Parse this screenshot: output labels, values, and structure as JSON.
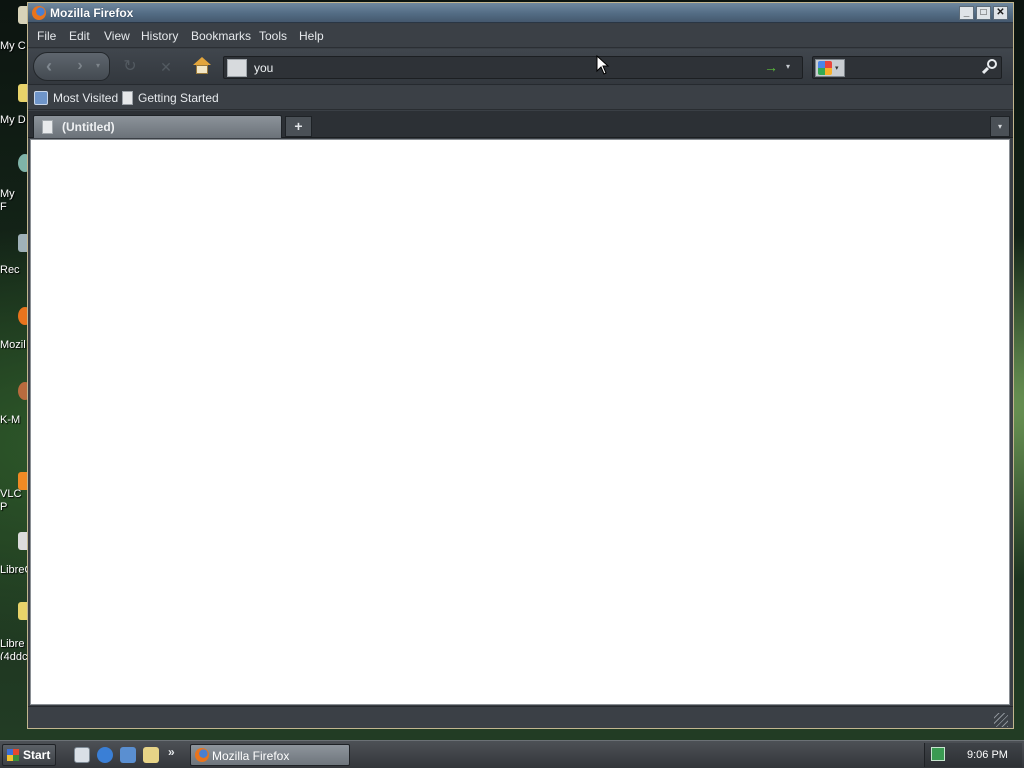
{
  "desktop": {
    "icons": [
      "My C",
      "My D",
      "My\nF",
      "Rec",
      "Mozil",
      "K-M",
      "VLC\nP",
      "LibreO",
      "Libre\n(4ddc"
    ]
  },
  "window": {
    "title": "Mozilla Firefox",
    "controls": {
      "minimize": "_",
      "maximize": "□",
      "close": "✕"
    }
  },
  "menubar": {
    "items": [
      "File",
      "Edit",
      "View",
      "History",
      "Bookmarks",
      "Tools",
      "Help"
    ]
  },
  "navbar": {
    "back_icon": "‹",
    "forward_icon": "›",
    "history_dropdown": "▾",
    "reload_icon": "↻",
    "stop_icon": "✕",
    "url_value": "you",
    "go_icon": "→",
    "url_dropdown": "▾",
    "search_engine_dropdown": "▾",
    "search_value": ""
  },
  "bookmarks": {
    "items": [
      "Most Visited",
      "Getting Started"
    ]
  },
  "tabs": {
    "items": [
      {
        "label": "(Untitled)",
        "selected": true
      }
    ],
    "new_tab": "+",
    "list_all": "▾"
  },
  "statusbar": {
    "text": ""
  },
  "taskbar": {
    "start_label": "Start",
    "overflow": "»",
    "tasks": [
      {
        "label": "Mozilla Firefox",
        "active": true
      }
    ],
    "clock": "9:06 PM"
  },
  "colors": {
    "titlebar": "#536c84",
    "chrome": "#3b4046",
    "content": "#ffffff"
  }
}
